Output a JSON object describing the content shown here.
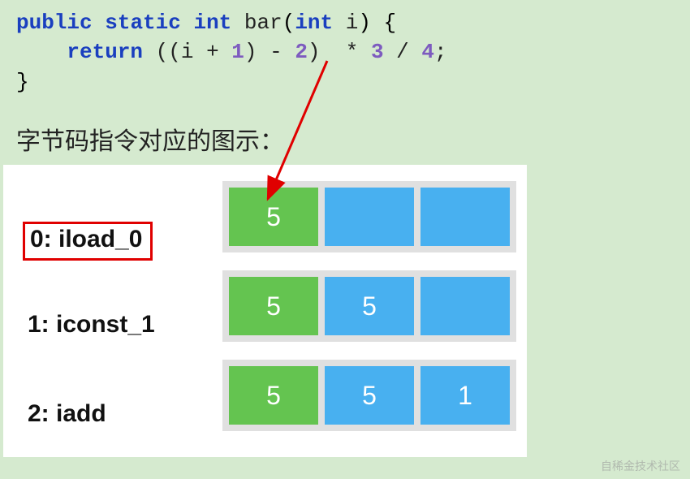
{
  "code": {
    "line1": {
      "kw_public": "public",
      "kw_static": "static",
      "kw_int": "int",
      "fn": "bar",
      "param_type": "int",
      "param_name": "i"
    },
    "line2": {
      "kw_return": "return",
      "expr_open": "((i + ",
      "n1": "1",
      "mid1": ") - ",
      "n2": "2",
      "mid2": ")  * ",
      "n3": "3",
      "mid3": " / ",
      "n4": "4",
      "end": ";"
    }
  },
  "caption": "字节码指令对应的图示：",
  "instructions": {
    "i0": "0: iload_0",
    "i1": "1: iconst_1",
    "i2": "2: iadd"
  },
  "stacks": {
    "row0": {
      "c0": "5",
      "c1": "",
      "c2": ""
    },
    "row1": {
      "c0": "5",
      "c1": "5",
      "c2": ""
    },
    "row2": {
      "c0": "5",
      "c1": "5",
      "c2": "1"
    }
  },
  "watermark": "自稀金技术社区"
}
